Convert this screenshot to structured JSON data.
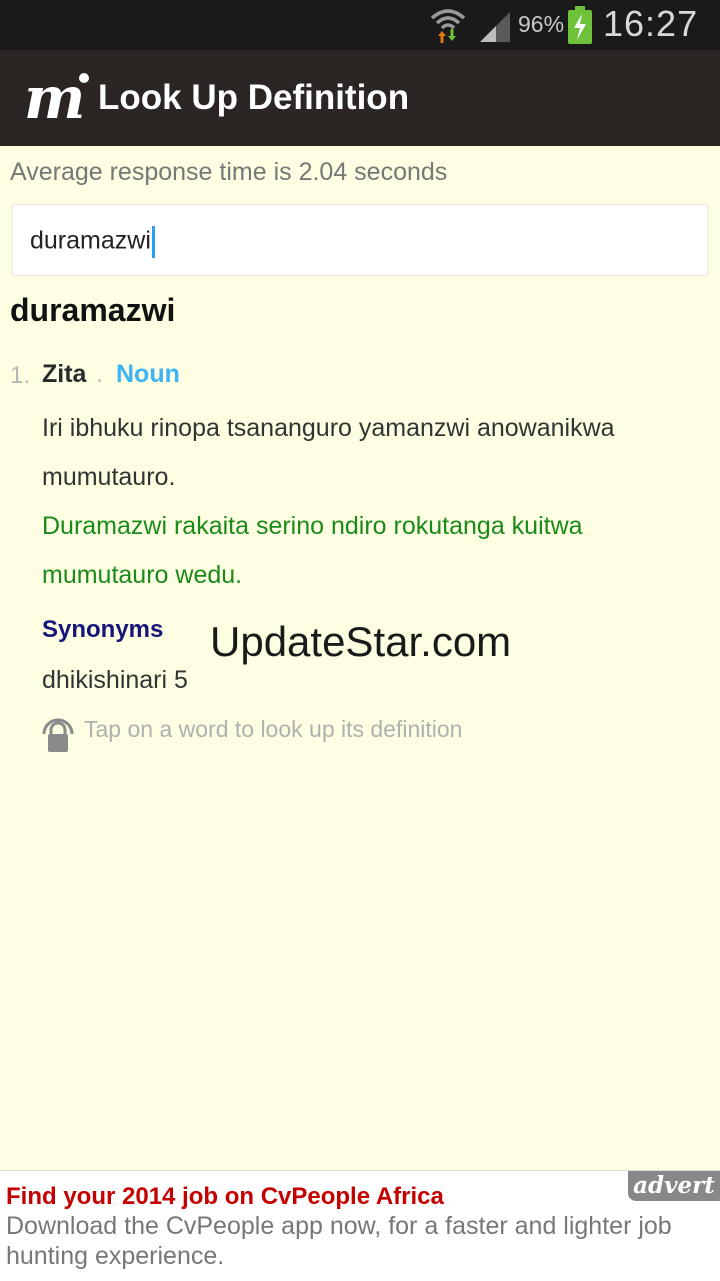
{
  "status_bar": {
    "battery_percent": "96%",
    "time": "16:27"
  },
  "action_bar": {
    "title": "Look Up Definition",
    "logo_icon": "m-logo-icon"
  },
  "response_time": "Average response time is 2.04 seconds",
  "search": {
    "value": "duramazwi"
  },
  "result": {
    "headword": "duramazwi",
    "senses": [
      {
        "number": "1.",
        "word": "Zita",
        "separator": ".",
        "part_of_speech": "Noun",
        "definition": "Iri ibhuku rinopa tsananguro yamanzwi anowanikwa mumutauro.",
        "example": "Duramazwi rakaita serino ndiro rokutanga kuitwa mumutauro wedu."
      }
    ],
    "synonyms_label": "Synonyms",
    "synonyms": "dhikishinari 5"
  },
  "watermark": "UpdateStar.com",
  "hint": "Tap on a word to look up its definition",
  "ad": {
    "badge": "advert",
    "title": "Find your 2014 job on CvPeople Africa",
    "body": "Download the CvPeople app now, for a faster and lighter job hunting experience."
  },
  "colors": {
    "background": "#fefee2",
    "action_bar": "#2b2624",
    "part_of_speech": "#3cb4f5",
    "example": "#1a8a1a",
    "synonyms_label": "#15157a",
    "ad_title": "#c40000"
  }
}
